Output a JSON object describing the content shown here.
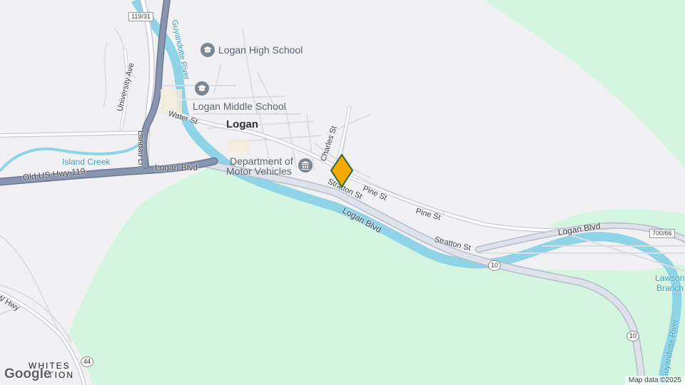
{
  "map": {
    "city_label": "Logan",
    "pois": [
      {
        "name": "Logan High School",
        "icon": "school-icon"
      },
      {
        "name": "Logan Middle School",
        "icon": "school-icon"
      },
      {
        "name": "Department of Motor Vehicles",
        "line1": "Department of",
        "line2": "Motor Vehicles",
        "icon": "government-building-icon"
      }
    ],
    "streets": {
      "water_st": "Water St",
      "logan_blvd_west": "Logan Blvd",
      "logan_blvd_main": "Logan Blvd",
      "logan_blvd_east": "Logan Blvd",
      "old_us_hwy": "Old US Hwy 119",
      "landau_ln": "Landau Ln",
      "university_ave": "University Ave",
      "charles_st": "Charles St",
      "stratton_st_1": "Stratton St",
      "stratton_st_2": "Stratton St",
      "pine_st_1": "Pine St",
      "pine_st_2": "Pine St",
      "w_hwy": "W Hwy"
    },
    "water": {
      "guyandotte_river_north": "Guyandotte River",
      "guyandotte_river_east": "Guyandotte River",
      "island_creek": "Island Creek",
      "lawson_branch_line1": "Lawson",
      "lawson_branch_line2": "Branch"
    },
    "places": {
      "whitesville_line1": "WHITES",
      "whitesville_line2": "ITION"
    },
    "shields": {
      "us_119_31": "119/31",
      "route_700_66": "700/66",
      "route_10_a": "10",
      "route_10_b": "10",
      "route_44": "44"
    },
    "marker_color": "#f9a800",
    "colors": {
      "land": "#f1f1f4",
      "forest": "#d4f5df",
      "water": "#8fd4e6",
      "highway": "#8895b0",
      "road": "#ffffff"
    }
  },
  "attribution": "Map data ©2025",
  "logo": "Google"
}
